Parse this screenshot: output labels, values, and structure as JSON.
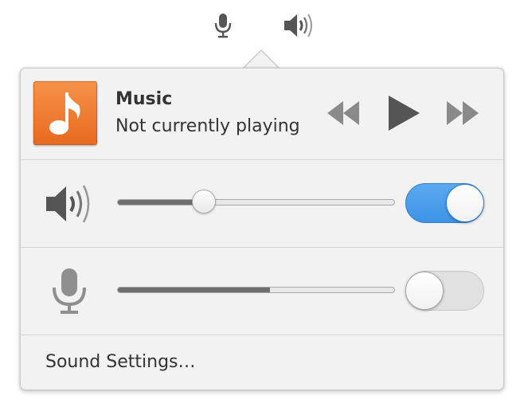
{
  "indicators": {
    "mic_icon": "microphone-icon",
    "volume_icon": "speaker-volume-icon"
  },
  "music": {
    "album_icon": "music-note-icon",
    "title": "Music",
    "status": "Not currently playing",
    "controls": {
      "previous_icon": "skip-backward-icon",
      "play_icon": "play-icon",
      "next_icon": "skip-forward-icon"
    }
  },
  "output": {
    "icon": "speaker-volume-icon",
    "level": 0.31,
    "enabled": true
  },
  "input": {
    "icon": "microphone-icon",
    "level": 0.55,
    "enabled": false
  },
  "settings": {
    "label": "Sound Settings…"
  },
  "colors": {
    "accent": "#3f93e6",
    "album": "#e76a1f"
  }
}
